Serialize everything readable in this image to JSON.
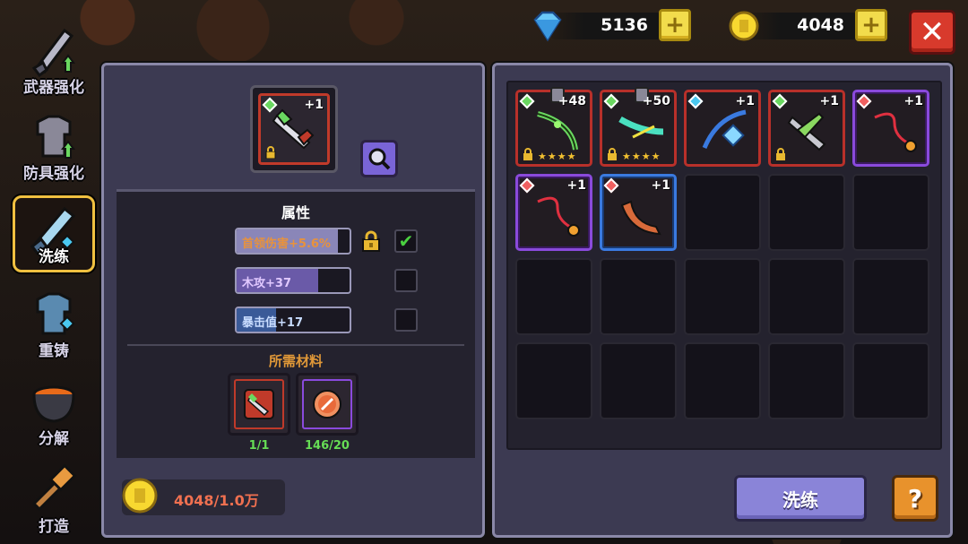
{
  "nav": {
    "items": [
      {
        "label": "武器强化",
        "icon": "sword-upgrade-icon"
      },
      {
        "label": "防具强化",
        "icon": "armor-upgrade-icon"
      },
      {
        "label": "洗练",
        "icon": "refine-sword-icon",
        "active": true
      },
      {
        "label": "重铸",
        "icon": "reforge-armor-icon"
      },
      {
        "label": "分解",
        "icon": "cauldron-icon"
      },
      {
        "label": "打造",
        "icon": "hammer-icon"
      }
    ]
  },
  "currency": {
    "gems": "5136",
    "coins": "4048",
    "plus": "+"
  },
  "close_label": "✕",
  "selected_item": {
    "level": "+1",
    "rarity_color": "#c03a2a"
  },
  "attributes": {
    "title": "属性",
    "rows": [
      {
        "text": "首领伤害+5.6%",
        "fill": 0.9,
        "locked": true,
        "checked": true,
        "color": "#e8923c"
      },
      {
        "text": "木攻+37",
        "fill": 0.72,
        "locked": false,
        "checked": false,
        "color": "#c09cf0"
      },
      {
        "text": "暴击值+17",
        "fill": 0.35,
        "locked": false,
        "checked": false,
        "color": "#a8c8f8"
      }
    ],
    "check_mark": "✔"
  },
  "materials": {
    "title": "所需材料",
    "items": [
      {
        "count": "1/1",
        "border": "#c03a2a"
      },
      {
        "count": "146/20",
        "border": "#8a4adc"
      }
    ]
  },
  "cost": {
    "text": "4048/1.0万"
  },
  "inventory": {
    "items": [
      {
        "level": "+48",
        "rarity": "red",
        "gem_color": "#6ad860",
        "stars": "★★★★",
        "pinned": true,
        "locked": true
      },
      {
        "level": "+50",
        "rarity": "red",
        "gem_color": "#6ad860",
        "stars": "★★★★",
        "pinned": true,
        "locked": true
      },
      {
        "level": "+1",
        "rarity": "red",
        "gem_color": "#4ac8f0",
        "stars": "",
        "pinned": false,
        "locked": false
      },
      {
        "level": "+1",
        "rarity": "red",
        "gem_color": "#6ad860",
        "stars": "",
        "pinned": false,
        "locked": true
      },
      {
        "level": "+1",
        "rarity": "purple",
        "gem_color": "#f06060",
        "stars": "",
        "pinned": false,
        "locked": false
      },
      {
        "level": "+1",
        "rarity": "purple",
        "gem_color": "#f06060",
        "stars": "",
        "pinned": false,
        "locked": false
      },
      {
        "level": "+1",
        "rarity": "blue",
        "gem_color": "#f06060",
        "stars": "",
        "pinned": false,
        "locked": false
      }
    ],
    "total_slots": 20
  },
  "buttons": {
    "wash": "洗练",
    "help": "?"
  }
}
